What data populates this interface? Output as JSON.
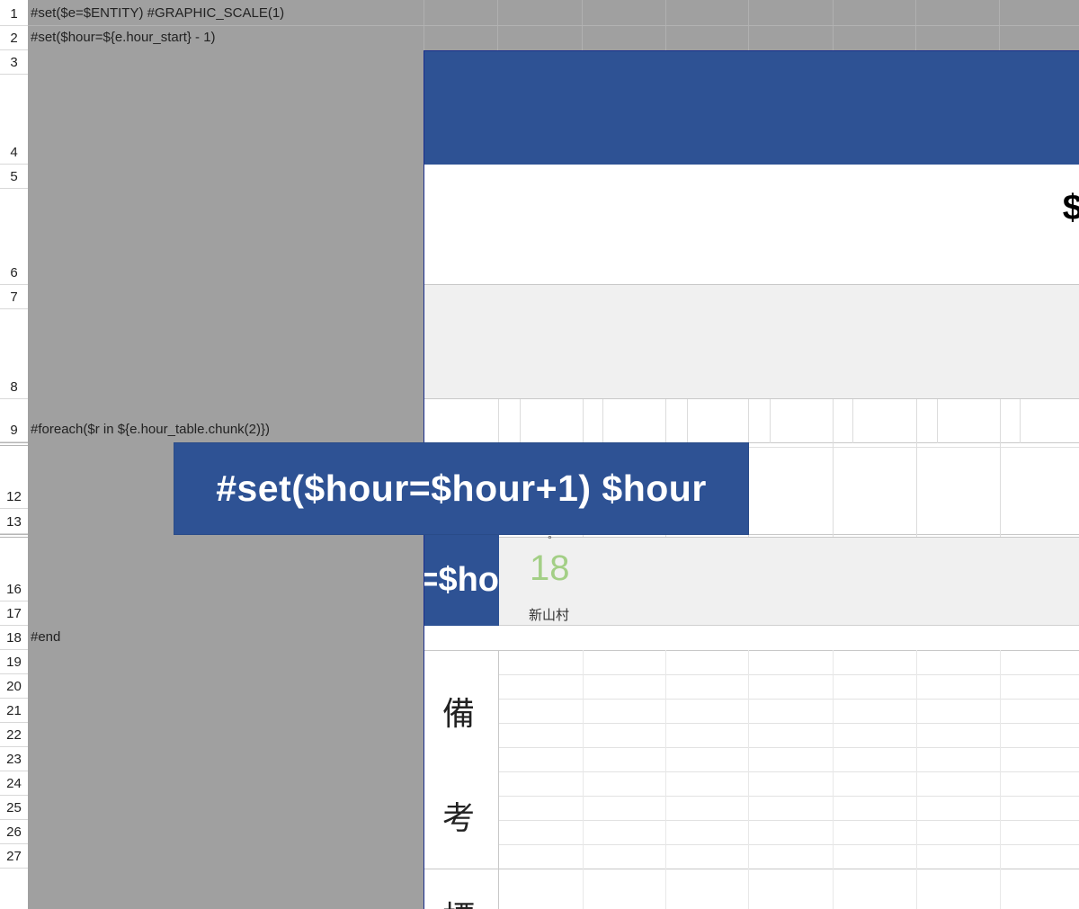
{
  "rows": [
    "1",
    "2",
    "3",
    "4",
    "5",
    "6",
    "7",
    "8",
    "9",
    "12",
    "13",
    "16",
    "17",
    "18",
    "19",
    "20",
    "21",
    "22",
    "23",
    "24",
    "25",
    "26",
    "27"
  ],
  "cells": {
    "r1": "#set($e=$ENTITY) #GRAPHIC_SCALE(1)",
    "r2": "#set($hour=${e.hour_start} - 1)",
    "r9": "#foreach($r in ${e.hour_table.chunk(2)})",
    "r18": "#end"
  },
  "form": {
    "dollar": "$",
    "blue_cell": "=$ho",
    "degree": "°",
    "number": "18",
    "village": "新山村",
    "remarks_1": "備",
    "remarks_2": "考",
    "cutoff_char": "標"
  },
  "overlay": {
    "text": "#set($hour=$hour+1) $hour"
  },
  "colors": {
    "sheet_gray": "#a0a0a0",
    "header_blue": "#2e5294",
    "band_light": "#f0f0f0",
    "green_number": "#a3cf86"
  }
}
